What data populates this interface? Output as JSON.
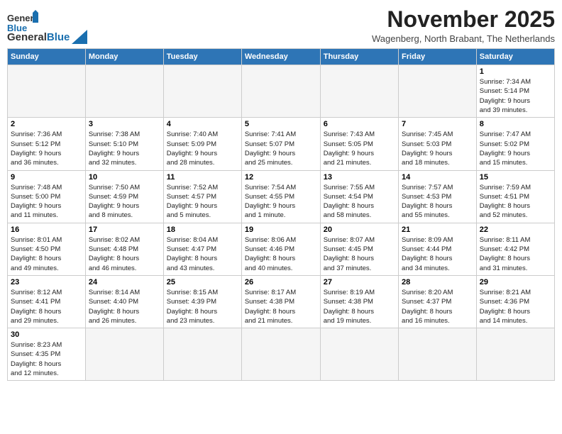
{
  "header": {
    "logo_general": "General",
    "logo_blue": "Blue",
    "month_title": "November 2025",
    "subtitle": "Wagenberg, North Brabant, The Netherlands"
  },
  "weekdays": [
    "Sunday",
    "Monday",
    "Tuesday",
    "Wednesday",
    "Thursday",
    "Friday",
    "Saturday"
  ],
  "weeks": [
    [
      {
        "day": "",
        "info": ""
      },
      {
        "day": "",
        "info": ""
      },
      {
        "day": "",
        "info": ""
      },
      {
        "day": "",
        "info": ""
      },
      {
        "day": "",
        "info": ""
      },
      {
        "day": "",
        "info": ""
      },
      {
        "day": "1",
        "info": "Sunrise: 7:34 AM\nSunset: 5:14 PM\nDaylight: 9 hours\nand 39 minutes."
      }
    ],
    [
      {
        "day": "2",
        "info": "Sunrise: 7:36 AM\nSunset: 5:12 PM\nDaylight: 9 hours\nand 36 minutes."
      },
      {
        "day": "3",
        "info": "Sunrise: 7:38 AM\nSunset: 5:10 PM\nDaylight: 9 hours\nand 32 minutes."
      },
      {
        "day": "4",
        "info": "Sunrise: 7:40 AM\nSunset: 5:09 PM\nDaylight: 9 hours\nand 28 minutes."
      },
      {
        "day": "5",
        "info": "Sunrise: 7:41 AM\nSunset: 5:07 PM\nDaylight: 9 hours\nand 25 minutes."
      },
      {
        "day": "6",
        "info": "Sunrise: 7:43 AM\nSunset: 5:05 PM\nDaylight: 9 hours\nand 21 minutes."
      },
      {
        "day": "7",
        "info": "Sunrise: 7:45 AM\nSunset: 5:03 PM\nDaylight: 9 hours\nand 18 minutes."
      },
      {
        "day": "8",
        "info": "Sunrise: 7:47 AM\nSunset: 5:02 PM\nDaylight: 9 hours\nand 15 minutes."
      }
    ],
    [
      {
        "day": "9",
        "info": "Sunrise: 7:48 AM\nSunset: 5:00 PM\nDaylight: 9 hours\nand 11 minutes."
      },
      {
        "day": "10",
        "info": "Sunrise: 7:50 AM\nSunset: 4:59 PM\nDaylight: 9 hours\nand 8 minutes."
      },
      {
        "day": "11",
        "info": "Sunrise: 7:52 AM\nSunset: 4:57 PM\nDaylight: 9 hours\nand 5 minutes."
      },
      {
        "day": "12",
        "info": "Sunrise: 7:54 AM\nSunset: 4:55 PM\nDaylight: 9 hours\nand 1 minute."
      },
      {
        "day": "13",
        "info": "Sunrise: 7:55 AM\nSunset: 4:54 PM\nDaylight: 8 hours\nand 58 minutes."
      },
      {
        "day": "14",
        "info": "Sunrise: 7:57 AM\nSunset: 4:53 PM\nDaylight: 8 hours\nand 55 minutes."
      },
      {
        "day": "15",
        "info": "Sunrise: 7:59 AM\nSunset: 4:51 PM\nDaylight: 8 hours\nand 52 minutes."
      }
    ],
    [
      {
        "day": "16",
        "info": "Sunrise: 8:01 AM\nSunset: 4:50 PM\nDaylight: 8 hours\nand 49 minutes."
      },
      {
        "day": "17",
        "info": "Sunrise: 8:02 AM\nSunset: 4:48 PM\nDaylight: 8 hours\nand 46 minutes."
      },
      {
        "day": "18",
        "info": "Sunrise: 8:04 AM\nSunset: 4:47 PM\nDaylight: 8 hours\nand 43 minutes."
      },
      {
        "day": "19",
        "info": "Sunrise: 8:06 AM\nSunset: 4:46 PM\nDaylight: 8 hours\nand 40 minutes."
      },
      {
        "day": "20",
        "info": "Sunrise: 8:07 AM\nSunset: 4:45 PM\nDaylight: 8 hours\nand 37 minutes."
      },
      {
        "day": "21",
        "info": "Sunrise: 8:09 AM\nSunset: 4:44 PM\nDaylight: 8 hours\nand 34 minutes."
      },
      {
        "day": "22",
        "info": "Sunrise: 8:11 AM\nSunset: 4:42 PM\nDaylight: 8 hours\nand 31 minutes."
      }
    ],
    [
      {
        "day": "23",
        "info": "Sunrise: 8:12 AM\nSunset: 4:41 PM\nDaylight: 8 hours\nand 29 minutes."
      },
      {
        "day": "24",
        "info": "Sunrise: 8:14 AM\nSunset: 4:40 PM\nDaylight: 8 hours\nand 26 minutes."
      },
      {
        "day": "25",
        "info": "Sunrise: 8:15 AM\nSunset: 4:39 PM\nDaylight: 8 hours\nand 23 minutes."
      },
      {
        "day": "26",
        "info": "Sunrise: 8:17 AM\nSunset: 4:38 PM\nDaylight: 8 hours\nand 21 minutes."
      },
      {
        "day": "27",
        "info": "Sunrise: 8:19 AM\nSunset: 4:38 PM\nDaylight: 8 hours\nand 19 minutes."
      },
      {
        "day": "28",
        "info": "Sunrise: 8:20 AM\nSunset: 4:37 PM\nDaylight: 8 hours\nand 16 minutes."
      },
      {
        "day": "29",
        "info": "Sunrise: 8:21 AM\nSunset: 4:36 PM\nDaylight: 8 hours\nand 14 minutes."
      }
    ],
    [
      {
        "day": "30",
        "info": "Sunrise: 8:23 AM\nSunset: 4:35 PM\nDaylight: 8 hours\nand 12 minutes."
      },
      {
        "day": "",
        "info": ""
      },
      {
        "day": "",
        "info": ""
      },
      {
        "day": "",
        "info": ""
      },
      {
        "day": "",
        "info": ""
      },
      {
        "day": "",
        "info": ""
      },
      {
        "day": "",
        "info": ""
      }
    ]
  ]
}
